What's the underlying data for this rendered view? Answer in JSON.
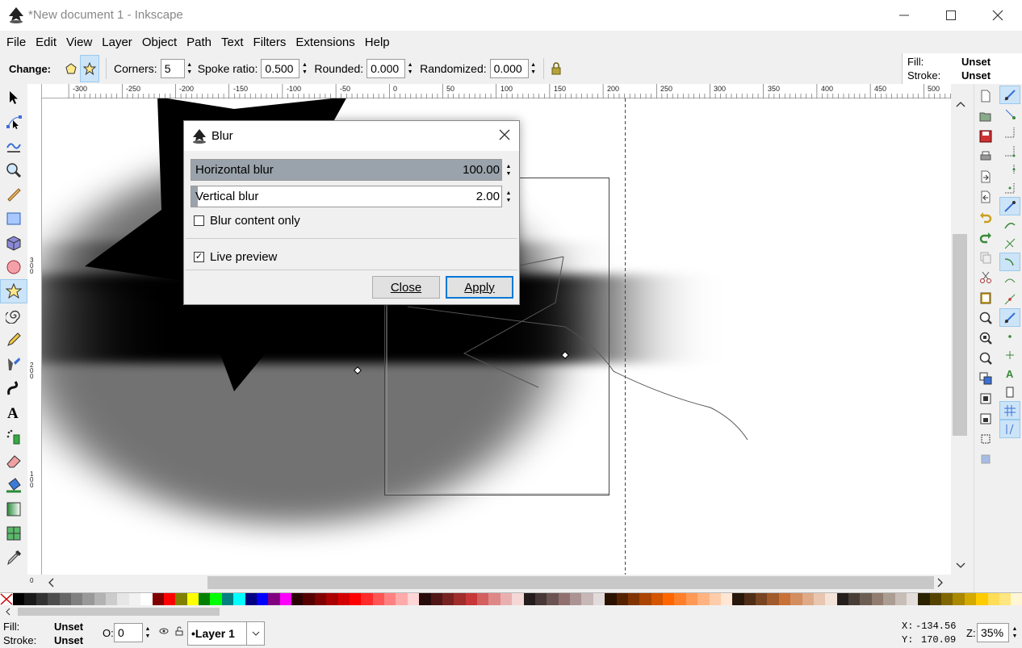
{
  "window": {
    "title": "*New document 1 - Inkscape"
  },
  "menu": [
    "File",
    "Edit",
    "View",
    "Layer",
    "Object",
    "Path",
    "Text",
    "Filters",
    "Extensions",
    "Help"
  ],
  "toolbar": {
    "change_label": "Change:",
    "corners_label": "Corners:",
    "corners_value": "5",
    "spoke_label": "Spoke ratio:",
    "spoke_value": "0.500",
    "rounded_label": "Rounded:",
    "rounded_value": "0.000",
    "randomized_label": "Randomized:",
    "randomized_value": "0.000"
  },
  "style_panel": {
    "fill_label": "Fill:",
    "fill_value": "Unset",
    "stroke_label": "Stroke:",
    "stroke_value": "Unset"
  },
  "hruler_labels": [
    "-300",
    "-250",
    "-200",
    "-150",
    "-100",
    "-50",
    "0",
    "50",
    "100",
    "150",
    "200",
    "250",
    "300",
    "350",
    "400",
    "450",
    "500"
  ],
  "vruler_labels": [
    "300",
    "200",
    "100",
    "0"
  ],
  "dialog": {
    "title": "Blur",
    "horizontal_label": "Horizontal blur",
    "horizontal_value": "100.00",
    "horizontal_fraction": 1.0,
    "vertical_label": "Vertical blur",
    "vertical_value": "2.00",
    "vertical_fraction": 0.02,
    "blur_content_label": "Blur content only",
    "blur_content_checked": false,
    "live_preview_label": "Live preview",
    "live_preview_checked": true,
    "close_label": "Close",
    "apply_label": "Apply"
  },
  "status": {
    "fill_label": "Fill:",
    "fill_value": "Unset",
    "stroke_label": "Stroke:",
    "stroke_value": "Unset",
    "opacity_label": "O:",
    "opacity_value": "0",
    "layer_value": "•Layer 1",
    "x_label": "X:",
    "x_value": "-134.56",
    "y_label": "Y:",
    "y_value": "170.09",
    "zoom_label": "Z:",
    "zoom_value": "35%"
  },
  "palette_colors": [
    "#000000",
    "#1a1a1a",
    "#333333",
    "#4d4d4d",
    "#666666",
    "#808080",
    "#999999",
    "#b3b3b3",
    "#cccccc",
    "#e6e6e6",
    "#f2f2f2",
    "#ffffff",
    "#800000",
    "#ff0000",
    "#808000",
    "#ffff00",
    "#008000",
    "#00ff00",
    "#008080",
    "#00ffff",
    "#000080",
    "#0000ff",
    "#800080",
    "#ff00ff",
    "#2b0000",
    "#550000",
    "#800000",
    "#aa0000",
    "#d40000",
    "#ff0000",
    "#ff2a2a",
    "#ff5555",
    "#ff8080",
    "#ffaaaa",
    "#ffd5d5",
    "#280b0b",
    "#501616",
    "#782121",
    "#a02c2c",
    "#c83737",
    "#d35f5f",
    "#de8787",
    "#e9afaf",
    "#f4d7d7",
    "#241c1c",
    "#483737",
    "#6c5353",
    "#916f6f",
    "#ac9393",
    "#c8b7b7",
    "#e3dbdb",
    "#2b1100",
    "#552200",
    "#803300",
    "#aa4400",
    "#d45500",
    "#ff6600",
    "#ff7f2a",
    "#ff9955",
    "#ffb380",
    "#ffccaa",
    "#ffe6d5",
    "#28170b",
    "#502d16",
    "#784421",
    "#a05a2c",
    "#c87137",
    "#d38d5f",
    "#deaa87",
    "#e9c6af",
    "#f4e3d7",
    "#241f1c",
    "#483e37",
    "#6c5d53",
    "#917c6f",
    "#ac9d93",
    "#c8beb7",
    "#e3dedb",
    "#2b2200",
    "#554400",
    "#806600",
    "#aa8800",
    "#d4aa00",
    "#ffcc00",
    "#ffdd55",
    "#ffe680",
    "#fff6d5"
  ]
}
